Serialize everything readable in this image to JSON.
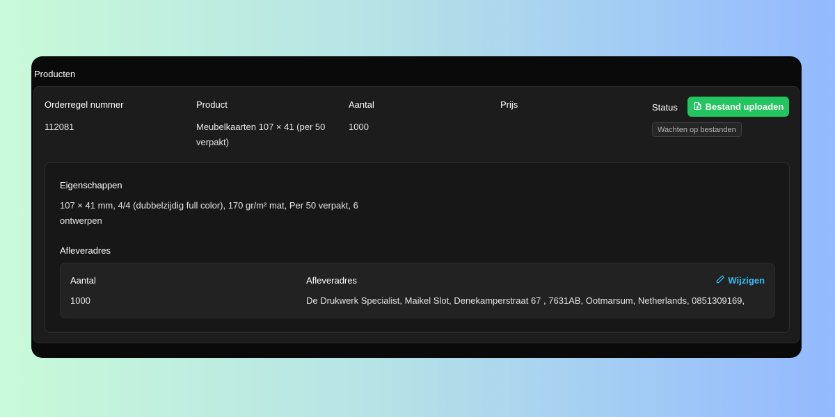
{
  "section": {
    "title": "Producten"
  },
  "order": {
    "headers": {
      "line_number": "Orderregel nummer",
      "product": "Product",
      "quantity": "Aantal",
      "price": "Prijs",
      "status": "Status"
    },
    "values": {
      "line_number": "112081",
      "product": "Meubelkaarten 107 × 41 (per 50 verpakt)",
      "quantity": "1000",
      "price": ""
    },
    "upload_button": "Bestand uploaden",
    "status_badge": "Wachten op bestanden"
  },
  "properties": {
    "title": "Eigenschappen",
    "text": "107 × 41 mm, 4/4 (dubbelzijdig full color), 170 gr/m² mat, Per 50 verpakt, 6 ontwerpen"
  },
  "delivery": {
    "title": "Afleveradres",
    "headers": {
      "quantity": "Aantal",
      "address": "Afleveradres"
    },
    "edit_label": "Wijzigen",
    "quantity": "1000",
    "address": "De Drukwerk Specialist, Maikel Slot, Denekamperstraat 67 , 7631AB, Ootmarsum, Netherlands, 0851309169,"
  },
  "colors": {
    "accent_green": "#22c55e",
    "link_blue": "#38bdf8",
    "background": "#0a0a0a"
  },
  "icons": {
    "upload": "file-plus-icon",
    "edit": "pencil-icon"
  }
}
